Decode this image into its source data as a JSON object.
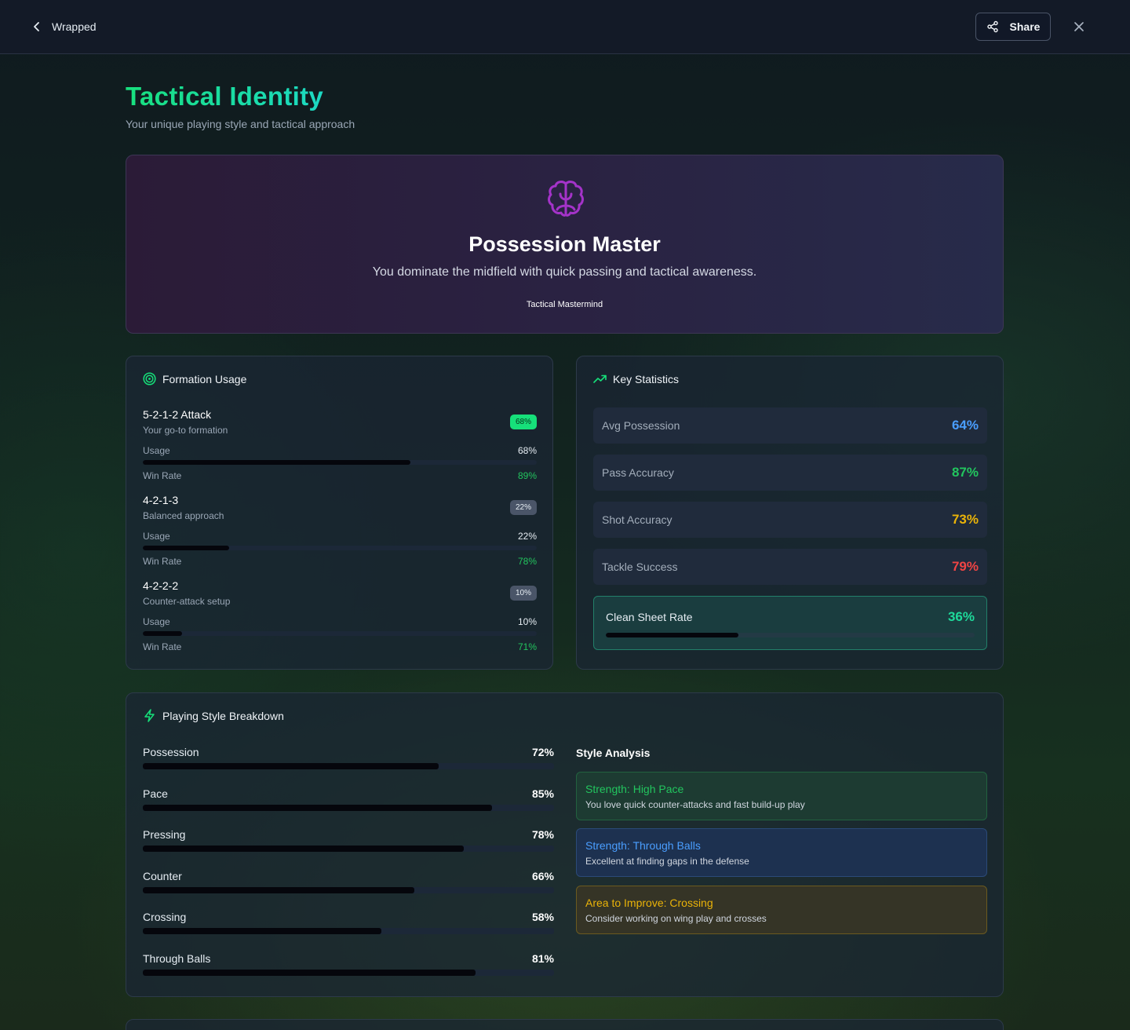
{
  "topbar": {
    "back_label": "Wrapped",
    "share_label": "Share"
  },
  "header": {
    "title": "Tactical Identity",
    "subtitle": "Your unique playing style and tactical approach"
  },
  "hero": {
    "icon": "brain-icon",
    "title": "Possession Master",
    "description": "You dominate the midfield with quick passing and tactical awareness.",
    "badge": "Tactical Mastermind"
  },
  "formation": {
    "heading": "Formation Usage",
    "usage_label": "Usage",
    "winrate_label": "Win Rate",
    "items": [
      {
        "name": "5-2-1-2 Attack",
        "desc": "Your go-to formation",
        "badge": "68%",
        "usage": "68%",
        "usage_value": 0.68,
        "win_rate": "89%",
        "badge_color": "#16e07a"
      },
      {
        "name": "4-2-1-3",
        "desc": "Balanced approach",
        "badge": "22%",
        "usage": "22%",
        "usage_value": 0.22,
        "win_rate": "78%",
        "badge_color": "#4a5568"
      },
      {
        "name": "4-2-2-2",
        "desc": "Counter-attack setup",
        "badge": "10%",
        "usage": "10%",
        "usage_value": 0.1,
        "win_rate": "71%",
        "badge_color": "#4a5568"
      }
    ]
  },
  "stats": {
    "heading": "Key Statistics",
    "items": [
      {
        "label": "Avg Possession",
        "value": "64%",
        "color": "#4a9eff"
      },
      {
        "label": "Pass Accuracy",
        "value": "87%",
        "color": "#22c55e"
      },
      {
        "label": "Shot Accuracy",
        "value": "73%",
        "color": "#eab308"
      },
      {
        "label": "Tackle Success",
        "value": "79%",
        "color": "#ef4444"
      }
    ],
    "clean_sheet": {
      "label": "Clean Sheet Rate",
      "value": "36%",
      "value_num": 0.36,
      "color": "#1ed99a"
    }
  },
  "style": {
    "heading": "Playing Style Breakdown",
    "items": [
      {
        "name": "Possession",
        "pct": "72%",
        "value": 0.72
      },
      {
        "name": "Pace",
        "pct": "85%",
        "value": 0.85
      },
      {
        "name": "Pressing",
        "pct": "78%",
        "value": 0.78
      },
      {
        "name": "Counter",
        "pct": "66%",
        "value": 0.66
      },
      {
        "name": "Crossing",
        "pct": "58%",
        "value": 0.58
      },
      {
        "name": "Through Balls",
        "pct": "81%",
        "value": 0.81
      }
    ],
    "analysis_title": "Style Analysis",
    "analysis": [
      {
        "title": "Strength: High Pace",
        "desc": "You love quick counter-attacks and fast build-up play"
      },
      {
        "title": "Strength: Through Balls",
        "desc": "Excellent at finding gaps in the defense"
      },
      {
        "title": "Area to Improve: Crossing",
        "desc": "Consider working on wing play and crosses"
      }
    ]
  },
  "colors": {
    "accent_green": "#16e07a",
    "accent_teal": "#1cd9c3",
    "hero_icon": "#a433c9"
  }
}
